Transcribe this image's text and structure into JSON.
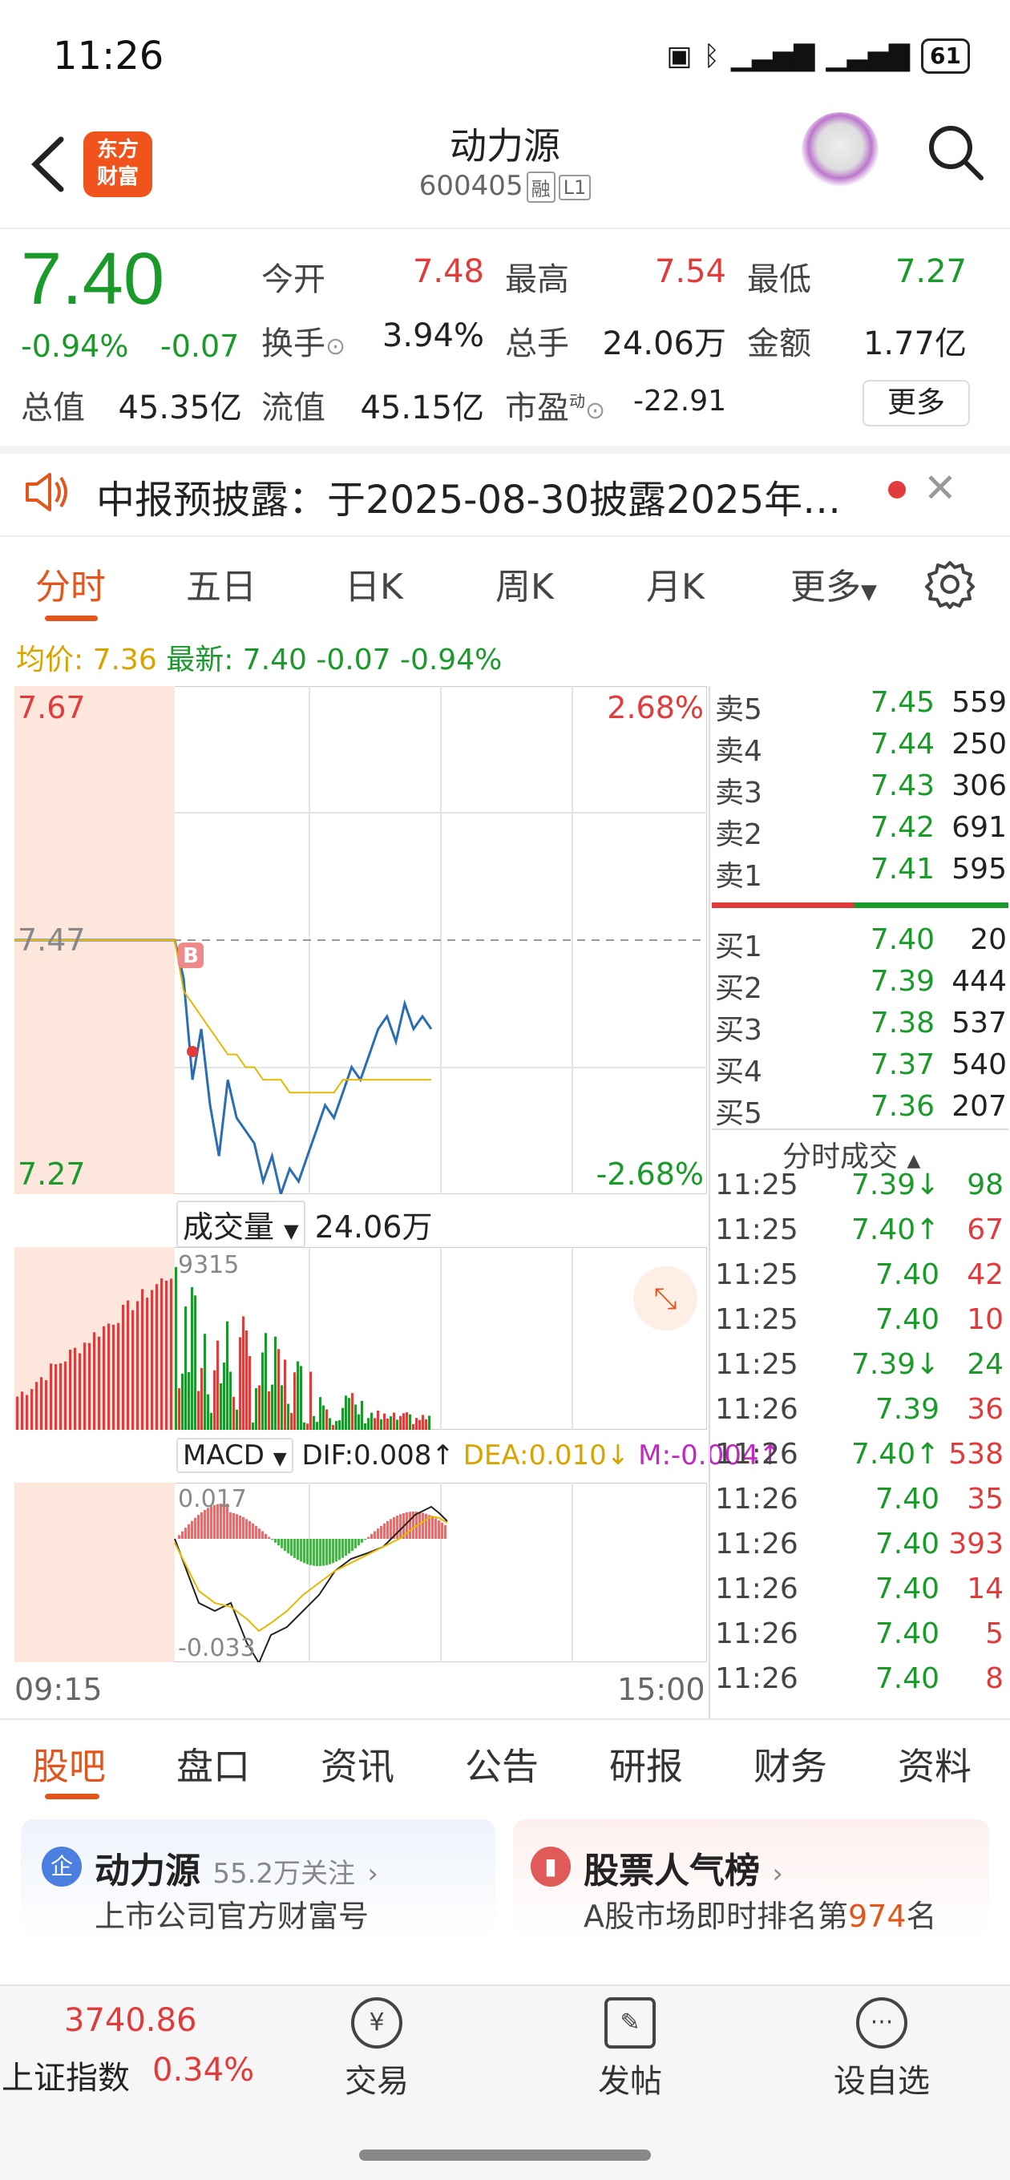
{
  "status_bar": {
    "time": "11:26",
    "battery": "61"
  },
  "header": {
    "logo_text_line1": "东方",
    "logo_text_line2": "财富",
    "stock_name": "动力源",
    "stock_code": "600405",
    "tag_margin": "融",
    "tag_level": "L1"
  },
  "quote": {
    "price": "7.40",
    "change_pct": "-0.94%",
    "change": "-0.07",
    "open_label": "今开",
    "open": "7.48",
    "high_label": "最高",
    "high": "7.54",
    "low_label": "最低",
    "low": "7.27",
    "turnover_label": "换手",
    "turnover": "3.94%",
    "volume_label": "总手",
    "volume": "24.06万",
    "amount_label": "金额",
    "amount": "1.77亿",
    "mcap_label": "总值",
    "mcap": "45.35亿",
    "float_label": "流值",
    "float": "45.15亿",
    "pe_label": "市盈",
    "pe_sup": "动",
    "pe": "-22.91",
    "more": "更多"
  },
  "announcement": {
    "text": "中报预披露：于2025-08-30披露2025年…"
  },
  "chart_tabs": [
    "分时",
    "五日",
    "日K",
    "周K",
    "月K",
    "更多"
  ],
  "legend": {
    "avg_label": "均价: 7.36",
    "latest_label": "最新: 7.40 -0.07 -0.94%"
  },
  "chart_labels": {
    "y_top": "7.67",
    "y_mid": "7.47",
    "y_bottom": "7.27",
    "pct_top": "2.68%",
    "pct_bottom": "-2.68%",
    "buy_marker": "B",
    "vol_dropdown": "成交量",
    "vol_total": "24.06万",
    "vol_max": "9315",
    "macd_dropdown": "MACD",
    "dif": "DIF:0.008↑",
    "dea": "DEA:0.010↓",
    "m": "M:-0.004↑",
    "macd_max": "0.017",
    "macd_min": "-0.033",
    "time_start": "09:15",
    "time_end": "15:00"
  },
  "chart_data": {
    "type": "line",
    "ylim": [
      7.27,
      7.67
    ],
    "prev_close": 7.47,
    "series": [
      {
        "name": "最新",
        "values": [
          7.47,
          7.47,
          7.44,
          7.36,
          7.4,
          7.34,
          7.3,
          7.36,
          7.33,
          7.32,
          7.31,
          7.28,
          7.3,
          7.27,
          7.29,
          7.28,
          7.3,
          7.32,
          7.34,
          7.33,
          7.35,
          7.37,
          7.36,
          7.38,
          7.4,
          7.41,
          7.39,
          7.42,
          7.4,
          7.41,
          7.4
        ]
      },
      {
        "name": "均价",
        "values": [
          7.47,
          7.47,
          7.43,
          7.42,
          7.41,
          7.4,
          7.39,
          7.38,
          7.38,
          7.37,
          7.37,
          7.36,
          7.36,
          7.36,
          7.35,
          7.35,
          7.35,
          7.35,
          7.35,
          7.35,
          7.36,
          7.36,
          7.36,
          7.36,
          7.36,
          7.36,
          7.36,
          7.36,
          7.36,
          7.36,
          7.36
        ]
      }
    ]
  },
  "order_book": {
    "asks": [
      {
        "label": "卖5",
        "price": "7.45",
        "vol": "559"
      },
      {
        "label": "卖4",
        "price": "7.44",
        "vol": "250"
      },
      {
        "label": "卖3",
        "price": "7.43",
        "vol": "306"
      },
      {
        "label": "卖2",
        "price": "7.42",
        "vol": "691"
      },
      {
        "label": "卖1",
        "price": "7.41",
        "vol": "595"
      }
    ],
    "bids": [
      {
        "label": "买1",
        "price": "7.40",
        "vol": "20"
      },
      {
        "label": "买2",
        "price": "7.39",
        "vol": "444"
      },
      {
        "label": "买3",
        "price": "7.38",
        "vol": "537"
      },
      {
        "label": "买4",
        "price": "7.37",
        "vol": "540"
      },
      {
        "label": "买5",
        "price": "7.36",
        "vol": "207"
      }
    ]
  },
  "trades_header": "分时成交",
  "trades": [
    {
      "time": "11:25",
      "price": "7.39↓",
      "vol": "98",
      "pc": "green",
      "vc": "green"
    },
    {
      "time": "11:25",
      "price": "7.40↑",
      "vol": "67",
      "pc": "green",
      "vc": "red"
    },
    {
      "time": "11:25",
      "price": "7.40",
      "vol": "42",
      "pc": "green",
      "vc": "red"
    },
    {
      "time": "11:25",
      "price": "7.40",
      "vol": "10",
      "pc": "green",
      "vc": "red"
    },
    {
      "time": "11:25",
      "price": "7.39↓",
      "vol": "24",
      "pc": "green",
      "vc": "green"
    },
    {
      "time": "11:26",
      "price": "7.39",
      "vol": "36",
      "pc": "green",
      "vc": "red"
    },
    {
      "time": "11:26",
      "price": "7.40↑",
      "vol": "538",
      "pc": "green",
      "vc": "red"
    },
    {
      "time": "11:26",
      "price": "7.40",
      "vol": "35",
      "pc": "green",
      "vc": "red"
    },
    {
      "time": "11:26",
      "price": "7.40",
      "vol": "393",
      "pc": "green",
      "vc": "red"
    },
    {
      "time": "11:26",
      "price": "7.40",
      "vol": "14",
      "pc": "green",
      "vc": "red"
    },
    {
      "time": "11:26",
      "price": "7.40",
      "vol": "5",
      "pc": "green",
      "vc": "red"
    },
    {
      "time": "11:26",
      "price": "7.40",
      "vol": "8",
      "pc": "green",
      "vc": "red"
    }
  ],
  "bottom_tabs": [
    "股吧",
    "盘口",
    "资讯",
    "公告",
    "研报",
    "财务",
    "资料"
  ],
  "cards": {
    "left_icon": "企",
    "left_title": "动力源",
    "left_meta": "55.2万关注",
    "left_sub": "上市公司官方财富号",
    "right_title": "股票人气榜",
    "right_sub_pre": "A股市场即时排名第",
    "right_rank": "974",
    "right_sub_post": "名"
  },
  "bottom_nav": {
    "index_value": "3740.86",
    "index_name": "上证指数",
    "index_pct": "0.34%",
    "trade": "交易",
    "post": "发帖",
    "watchlist": "设自选",
    "trade_icon": "¥"
  },
  "colors": {
    "up": "#e23b3b",
    "down": "#1a9a2a",
    "accent": "#e2561b",
    "avg_line": "#e6b800",
    "price_line": "#2a6db5"
  }
}
